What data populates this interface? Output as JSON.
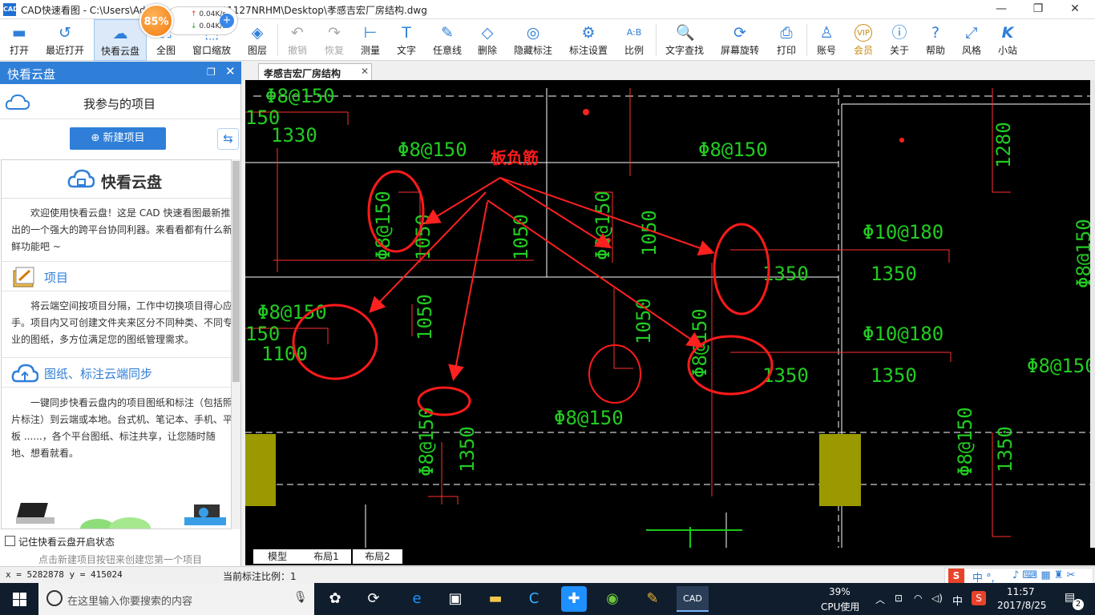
{
  "window": {
    "title": "CAD快速看图 - C:\\Users\\Ad",
    "title_rest": "41127NRHM\\Desktop\\孝感吉宏厂房结构.dwg",
    "minimize": "—",
    "restore": "❐",
    "close": "✕"
  },
  "speed": {
    "percent": "85%",
    "up": "0.04K/s",
    "down": "0.04K/s",
    "plus": "+"
  },
  "toolbar": {
    "items": [
      {
        "label": "打开",
        "icon": "folder-icon"
      },
      {
        "label": "最近打开",
        "icon": "clock-icon"
      },
      {
        "label": "快看云盘",
        "icon": "cloud-icon"
      },
      {
        "label": "全图",
        "icon": "expand-icon"
      },
      {
        "label": "窗口缩放",
        "icon": "zoom-window-icon"
      },
      {
        "label": "图层",
        "icon": "layers-icon"
      },
      {
        "label": "撤销",
        "icon": "undo-icon"
      },
      {
        "label": "恢复",
        "icon": "redo-icon"
      },
      {
        "label": "测量",
        "icon": "ruler-icon"
      },
      {
        "label": "文字",
        "icon": "text-icon"
      },
      {
        "label": "任意线",
        "icon": "pen-icon"
      },
      {
        "label": "删除",
        "icon": "eraser-icon"
      },
      {
        "label": "隐藏标注",
        "icon": "eye-off-icon"
      },
      {
        "label": "标注设置",
        "icon": "annotation-settings-icon"
      },
      {
        "label": "比例",
        "icon": "scale-icon"
      },
      {
        "label": "文字查找",
        "icon": "text-search-icon"
      },
      {
        "label": "屏幕旋转",
        "icon": "rotate-icon"
      },
      {
        "label": "打印",
        "icon": "printer-icon"
      },
      {
        "label": "账号",
        "icon": "user-icon"
      },
      {
        "label": "会员",
        "icon": "vip-icon"
      },
      {
        "label": "关于",
        "icon": "info-icon"
      },
      {
        "label": "帮助",
        "icon": "help-icon"
      },
      {
        "label": "风格",
        "icon": "style-icon"
      },
      {
        "label": "小站",
        "icon": "k-logo-icon"
      }
    ]
  },
  "panel": {
    "title": "快看云盘",
    "project_header": "我参与的项目",
    "new_project": "新建项目",
    "cloud_title": "快看云盘",
    "intro": "欢迎使用快看云盘！这是 CAD 快速看图最新推出的一个强大的跨平台协同利器。来看看都有什么新鲜功能吧 ~",
    "section1_title": "项目",
    "section1_text": "将云端空间按项目分隔，工作中切换项目得心应手。项目内又可创建文件夹来区分不同种类、不同专业的图纸，多方位满足您的图纸管理需求。",
    "section2_title": "图纸、标注云端同步",
    "section2_text": "一键同步快看云盘内的项目图纸和标注（包括照片标注）到云端或本地。台式机、笔记本、手机、平板 ......，各个平台图纸、标注共享，让您随时随地、想看就看。",
    "remember": "记住快看云盘开启状态",
    "hint": "点击新建项目按钮来创建您第一个项目"
  },
  "document": {
    "tab": "孝感吉宏厂房结构",
    "tab_close": "✕",
    "layout_tabs": [
      "模型",
      "布局1",
      "布局2"
    ],
    "annotation": "板负筋",
    "texts": {
      "t1": "Φ8@150",
      "t2": "150",
      "t3": "1330",
      "t4": "Φ8@150",
      "t5": "Φ8@150",
      "t6": "1280",
      "t7": "Φ8@150",
      "t8": "1050",
      "t9": "1050",
      "t10": "Φ8@150",
      "t11": "1050",
      "t12": "Φ10@180",
      "t13": "1350",
      "t14": "1350",
      "t15": "Φ8@150",
      "t16": "Φ8@150",
      "t17": "150",
      "t18": "1100",
      "t19": "1050",
      "t20": "1050",
      "t21": "Φ8@150",
      "t22": "Φ10@180",
      "t23": "1350",
      "t24": "1350",
      "t25": "Φ8@150",
      "t26": "Φ8@150",
      "t27": "Φ8@150",
      "t28": "1350",
      "t29": "Φ8@150",
      "t30": "1350"
    }
  },
  "status": {
    "coords": "x = 5282878  y = 415024",
    "scale": "当前标注比例：1"
  },
  "taskbar": {
    "search_placeholder": "在这里输入你要搜索的内容",
    "cpu_percent": "39%",
    "cpu_label": "CPU使用",
    "ime": "中",
    "time": "11:57",
    "date": "2017/8/25",
    "notifications": "2"
  }
}
